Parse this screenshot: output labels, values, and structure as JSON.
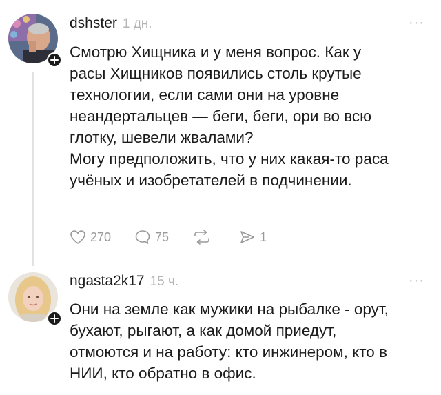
{
  "comments": [
    {
      "author": "dshster",
      "time": "1 дн.",
      "more": "···",
      "lines": [
        "Смотрю Хищника и у меня вопрос. Как у",
        "расы Хищников появились столь крутые",
        "технологии, если сами они на уровне",
        "неандертальцев — беги, беги, ори во всю",
        "глотку, шевели жвалами?",
        "Могу предположить, что у них какая-то раса",
        "учёных и изобретателей в подчинении."
      ],
      "likes": "270",
      "replies": "75",
      "reposts": "1"
    },
    {
      "author": "ngasta2k17",
      "time": "15 ч.",
      "more": "···",
      "lines": [
        "Они на земле как мужики на рыбалке - орут,",
        "бухают, рыгают, а как домой приедут,",
        "отмоются и на работу: кто инжинером, кто в",
        "НИИ, кто обратно в офис."
      ]
    }
  ],
  "colors": {
    "text": "#1b1b1b",
    "muted": "#b4b4b4",
    "icon": "#999999"
  }
}
